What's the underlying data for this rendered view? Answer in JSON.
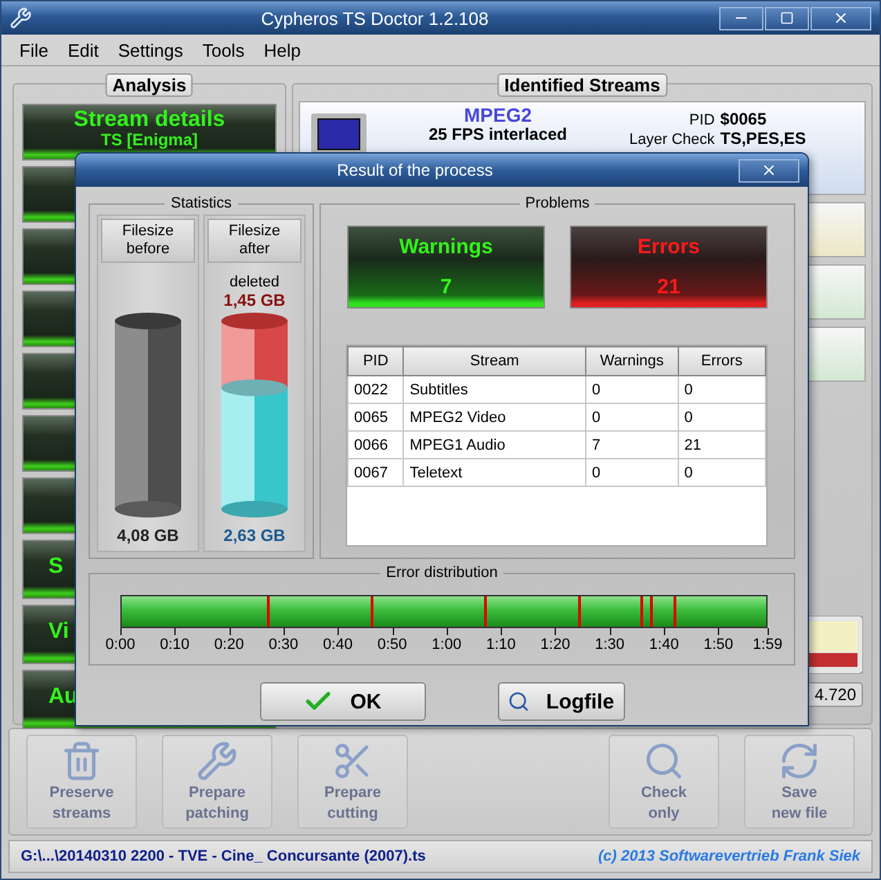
{
  "window": {
    "title": "Cypheros TS Doctor 1.2.108"
  },
  "menu": [
    "File",
    "Edit",
    "Settings",
    "Tools",
    "Help"
  ],
  "analysis": {
    "heading": "Analysis",
    "items": [
      {
        "kind": "labeled",
        "title": "Stream details",
        "subtitle": "TS [Enigma]"
      },
      {
        "kind": "covered"
      },
      {
        "kind": "covered"
      },
      {
        "kind": "covered"
      },
      {
        "kind": "covered"
      },
      {
        "kind": "covered"
      },
      {
        "kind": "covered"
      },
      {
        "kind": "truncated",
        "title": "S"
      },
      {
        "kind": "truncated",
        "title": "Vi"
      },
      {
        "kind": "truncated",
        "title": "Au"
      }
    ]
  },
  "streams": {
    "heading": "Identified Streams",
    "items": [
      {
        "kind": "video",
        "format": "MPEG2",
        "detail": "25 FPS interlaced",
        "pid_label": "PID",
        "pid": "$0065",
        "layer_label": "Layer Check",
        "layer": "TS,PES,ES"
      },
      {
        "kind": "covered",
        "color": "#ece7c6"
      },
      {
        "kind": "covered",
        "color": "#d3e8d3"
      },
      {
        "kind": "covered",
        "color": "#d3e8d3"
      }
    ],
    "meter": {
      "reading": "4.720"
    }
  },
  "toolbar": [
    {
      "kind": "preserve",
      "lines": [
        "Preserve",
        "streams"
      ],
      "disabled": true
    },
    {
      "kind": "patch",
      "lines": [
        "Prepare",
        "patching"
      ],
      "disabled": true
    },
    {
      "kind": "cut",
      "lines": [
        "Prepare",
        "cutting"
      ],
      "disabled": true
    },
    {
      "kind": "gap"
    },
    {
      "kind": "check",
      "lines": [
        "Check",
        "only"
      ],
      "disabled": true
    },
    {
      "kind": "save",
      "lines": [
        "Save",
        "new file"
      ],
      "disabled": true
    }
  ],
  "status": {
    "path": "G:\\...\\20140310 2200 - TVE - Cine_ Concursante (2007).ts",
    "copyright": "(c) 2013 Softwarevertrieb Frank Siek"
  },
  "dialog": {
    "title": "Result of the process",
    "statistics": {
      "heading": "Statistics",
      "columns": [
        {
          "kind": "before",
          "header": [
            "Filesize",
            "before"
          ],
          "size": "4,08 GB"
        },
        {
          "kind": "after",
          "header": [
            "Filesize",
            "after"
          ],
          "deleted_label": "deleted",
          "deleted": "1,45 GB",
          "size": "2,63 GB",
          "level": 0.645
        }
      ]
    },
    "problems": {
      "heading": "Problems",
      "counters": [
        {
          "kind": "warning",
          "label": "Warnings",
          "count": "7"
        },
        {
          "kind": "error",
          "label": "Errors",
          "count": "21"
        }
      ],
      "table": {
        "columns": [
          "PID",
          "Stream",
          "Warnings",
          "Errors"
        ],
        "rows": [
          [
            "0022",
            "Subtitles",
            "0",
            "0"
          ],
          [
            "0065",
            "MPEG2 Video",
            "0",
            "0"
          ],
          [
            "0066",
            "MPEG1 Audio",
            "7",
            "21"
          ],
          [
            "0067",
            "Teletext",
            "0",
            "0"
          ]
        ]
      }
    },
    "distribution": {
      "heading": "Error distribution",
      "ticks": [
        {
          "label": "0:00",
          "level": 0
        },
        {
          "label": "0:10",
          "level": 0.084
        },
        {
          "label": "0:20",
          "level": 0.168
        },
        {
          "label": "0:30",
          "level": 0.252
        },
        {
          "label": "0:40",
          "level": 0.336
        },
        {
          "label": "0:50",
          "level": 0.42
        },
        {
          "label": "1:00",
          "level": 0.504
        },
        {
          "label": "1:10",
          "level": 0.588
        },
        {
          "label": "1:20",
          "level": 0.672
        },
        {
          "label": "1:30",
          "level": 0.756
        },
        {
          "label": "1:40",
          "level": 0.84
        },
        {
          "label": "1:50",
          "level": 0.924
        },
        {
          "label": "1:59",
          "level": 1
        }
      ],
      "marks": [
        {
          "level": 0.228
        },
        {
          "level": 0.388
        },
        {
          "level": 0.565
        },
        {
          "level": 0.711
        },
        {
          "level": 0.806
        },
        {
          "level": 0.821
        },
        {
          "level": 0.859
        }
      ]
    },
    "buttons": [
      {
        "kind": "ok",
        "label": "OK"
      },
      {
        "kind": "log",
        "label": "Logfile"
      }
    ]
  }
}
